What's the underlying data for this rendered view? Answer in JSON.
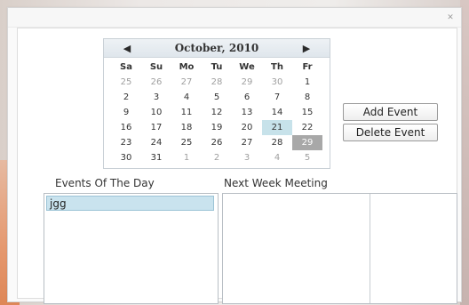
{
  "window": {
    "close_label": "✕"
  },
  "calendar": {
    "title": "October, 2010",
    "prev_label": "◀",
    "next_label": "▶",
    "weekdays": [
      "Sa",
      "Su",
      "Mo",
      "Tu",
      "We",
      "Th",
      "Fr"
    ],
    "weeks": [
      [
        "25",
        "26",
        "27",
        "28",
        "29",
        "30",
        "1"
      ],
      [
        "2",
        "3",
        "4",
        "5",
        "6",
        "7",
        "8"
      ],
      [
        "9",
        "10",
        "11",
        "12",
        "13",
        "14",
        "15"
      ],
      [
        "16",
        "17",
        "18",
        "19",
        "20",
        "21",
        "22"
      ],
      [
        "23",
        "24",
        "25",
        "26",
        "27",
        "28",
        "29"
      ],
      [
        "30",
        "31",
        "1",
        "2",
        "3",
        "4",
        "5"
      ]
    ],
    "today": "21",
    "selected": "29",
    "today_color": "#c7e2ea",
    "selected_color": "#a8a8a8"
  },
  "buttons": {
    "add_event": "Add Event",
    "delete_event": "Delete Event"
  },
  "labels": {
    "events_of_the_day": "Events Of The Day",
    "next_week_meeting": "Next Week Meeting"
  },
  "events_list": {
    "items": [
      "jgg"
    ],
    "selected_index": 0
  }
}
